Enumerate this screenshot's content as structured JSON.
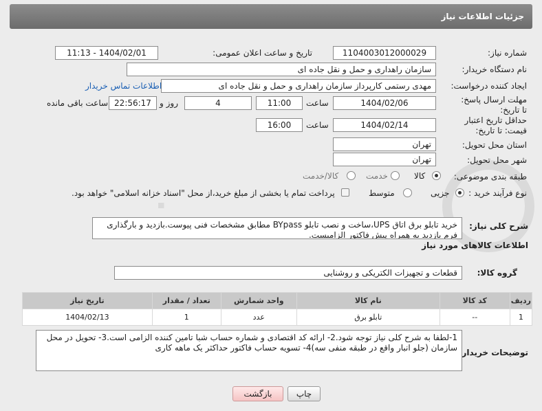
{
  "header": {
    "title": "جزئیات اطلاعات نیاز"
  },
  "labels": {
    "need_number": "شماره نیاز:",
    "announce_datetime": "تاریخ و ساعت اعلان عمومی:",
    "buyer_org": "نام دستگاه خریدار:",
    "requester": "ایجاد کننده درخواست:",
    "reply_deadline": "مهلت ارسال پاسخ: تا تاریخ:",
    "price_validity": "حداقل تاریخ اعتبار قیمت: تا تاریخ:",
    "delivery_province": "استان محل تحویل:",
    "delivery_city": "شهر محل تحویل:",
    "category": "طبقه بندی موضوعی:",
    "purchase_process": "نوع فرآیند خرید :",
    "general_description": "شرح کلی نیاز:",
    "goods_info": "اطلاعات کالاهای مورد نیاز",
    "goods_group": "گروه کالا:",
    "buyer_notes": "توضیحات خریدار:",
    "time": "ساعت",
    "day_and": "روز و",
    "remaining": "ساعت باقی مانده"
  },
  "fields": {
    "need_number": "1104003012000029",
    "announce_datetime": "1404/02/01 - 11:13",
    "buyer_org": "سازمان راهداری و حمل و نقل جاده ای",
    "requester": "مهدی رستمی کارپرداز سازمان راهداری و حمل و نقل جاده ای",
    "buyer_contact_link": "اطلاعات تماس خریدار",
    "reply_date": "1404/02/06",
    "reply_time": "11:00",
    "reply_days": "4",
    "reply_remaining": "22:56:17",
    "validity_date": "1404/02/14",
    "validity_time": "16:00",
    "delivery_province": "تهران",
    "delivery_city": "تهران"
  },
  "category_options": {
    "goods": "کالا",
    "service": "خدمت",
    "goods_service": "کالا/خدمت"
  },
  "process_options": {
    "partial": "جزیی",
    "medium": "متوسط",
    "treasury_note": "پرداخت تمام یا بخشی از مبلغ خرید،از محل \"اسناد خزانه اسلامی\" خواهد بود."
  },
  "general_description": "خرید تابلو برق اتاق UPS،ساخت و نصب تابلو BYpass مطابق مشخصات فنی پیوست.بازدید و بارگذاری فرم بازدید به همراه پیش فاکتور الزامیست.",
  "goods_group": "قطعات و تجهیزات الکتریکی و روشنایی",
  "table": {
    "headers": [
      "ردیف",
      "کد کالا",
      "نام کالا",
      "واحد شمارش",
      "تعداد / مقدار",
      "تاریخ نیاز"
    ],
    "rows": [
      [
        "1",
        "--",
        "تابلو برق",
        "عدد",
        "1",
        "1404/02/13"
      ]
    ]
  },
  "buyer_notes": "1-لطفا به شرح کلی نیاز توجه شود.2- ارائه کد اقتصادی و شماره حساب شبا تامین کننده الزامی است.3- تحویل در محل سازمان (جلو انبار واقع در طبقه منفی سه)4- تسویه حساب فاکتور حداکثر یک ماهه کاری",
  "buttons": {
    "print": "چاپ",
    "back": "بازگشت"
  },
  "watermark": {
    "text": "AriaTender.net"
  }
}
